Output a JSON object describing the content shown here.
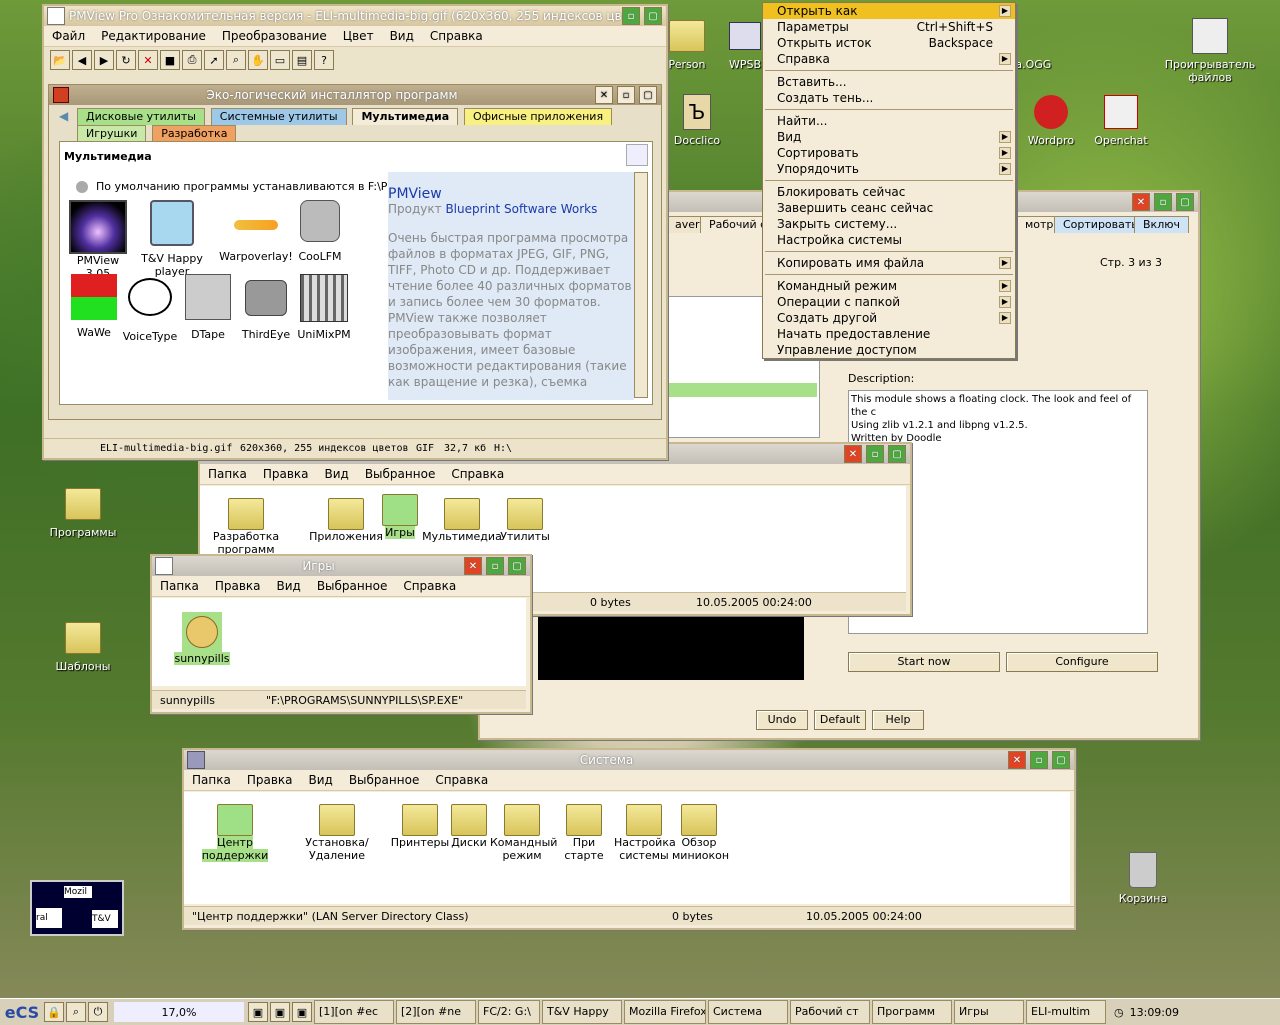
{
  "desktop": {
    "icons": [
      {
        "label": "Programs_label",
        "text": "Программы"
      },
      {
        "label": "templates",
        "text": "Шаблоны"
      },
      {
        "label": "trash",
        "text": "Корзина"
      },
      {
        "label": "player",
        "text": "Проигрыватель файлов"
      },
      {
        "label": "docclico",
        "text": "Docclico"
      },
      {
        "label": "wordpro",
        "text": "Wordpro"
      },
      {
        "label": "openchat",
        "text": "Openchat"
      },
      {
        "label": "person",
        "text": "Person"
      },
      {
        "label": "wpsb",
        "text": "WPSB"
      },
      {
        "label": "ogg",
        "text": "ка.OGG"
      }
    ],
    "mini_monitor": {
      "l1": "Mozil",
      "l2": "T&V",
      "l3": "ral"
    }
  },
  "pmview": {
    "title": "PMView Pro Ознакомительная версия - ELI-multimedia-big.gif (620x360, 255 индексов цв",
    "menu": [
      "Файл",
      "Редактирование",
      "Преобразование",
      "Цвет",
      "Вид",
      "Справка"
    ],
    "status": [
      "ELI-multimedia-big.gif",
      "620x360, 255 индексов цветов",
      "GIF",
      "32,7 кб",
      "H:\\"
    ]
  },
  "installer": {
    "title": "Эко-логический инсталлятор программ",
    "tabs": [
      "Дисковые утилиты",
      "Системные утилиты",
      "Мультимедиа",
      "Офисные приложения",
      "Игрушки",
      "Разработка"
    ],
    "section": "Мультимедиа",
    "default_path": "По умолчанию программы устанавливаются в F:\\PROGRAMS",
    "apps": [
      "PMView 3.05",
      "T&V Happy player",
      "Warpoverlay!",
      "CooLFM",
      "WaWe",
      "VoiceType",
      "DTape",
      "ThirdEye",
      "UniMixPM"
    ],
    "desc_title": "PMView",
    "desc_vendor_prefix": "Продукт",
    "desc_vendor": "Blueprint Software Works",
    "desc_text": "Очень быстрая программа просмотра файлов в форматах JPEG, GIF, PNG, TIFF, Photo CD и др. Поддерживает чтение более 40 различных форматов и запись более чем 30 форматов. PMView также позволяет преобразовывать формат изображения, имеет базовые возможности редактирования (такие как вращение и резка), съемка"
  },
  "context_menu": {
    "items": [
      {
        "label": "Открыть как",
        "accel": "",
        "arrow": true,
        "sel": true
      },
      {
        "label": "Параметры",
        "accel": "Ctrl+Shift+S",
        "arrow": false
      },
      {
        "label": "Открыть исток",
        "accel": "Backspace",
        "arrow": false
      },
      {
        "label": "Справка",
        "accel": "",
        "arrow": true
      },
      {
        "sep": true
      },
      {
        "label": "Вставить...",
        "accel": "",
        "arrow": false
      },
      {
        "label": "Создать тень...",
        "accel": "",
        "arrow": false
      },
      {
        "sep": true
      },
      {
        "label": "Найти...",
        "accel": "",
        "arrow": false
      },
      {
        "label": "Вид",
        "accel": "",
        "arrow": true
      },
      {
        "label": "Сортировать",
        "accel": "",
        "arrow": true
      },
      {
        "label": "Упорядочить",
        "accel": "",
        "arrow": true
      },
      {
        "sep": true
      },
      {
        "label": "Блокировать сейчас",
        "accel": "",
        "arrow": false
      },
      {
        "label": "Завершить сеанс сейчас",
        "accel": "",
        "arrow": false
      },
      {
        "label": "Закрыть систему...",
        "accel": "",
        "arrow": false
      },
      {
        "label": "Настройка системы",
        "accel": "",
        "arrow": false
      },
      {
        "sep": true
      },
      {
        "label": "Копировать имя файла",
        "accel": "",
        "arrow": true
      },
      {
        "sep": true
      },
      {
        "label": "Командный режим",
        "accel": "",
        "arrow": true
      },
      {
        "label": "Операции с папкой",
        "accel": "",
        "arrow": true
      },
      {
        "label": "Создать другой",
        "accel": "",
        "arrow": true
      },
      {
        "label": "Начать предоставление",
        "accel": "",
        "arrow": false
      },
      {
        "label": "Управление доступом",
        "accel": "",
        "arrow": false
      }
    ]
  },
  "desktop_settings": {
    "tabs": [
      "aver",
      "Рабочий сто",
      "мотр",
      "Сортировать",
      "Включ"
    ],
    "page": "Стр. 3 из 3",
    "desc_label": "Description:",
    "desc_lines": [
      "This module shows a floating clock. The look and feel of the c",
      "Using zlib v1.2.1 and libpng v1.2.5.",
      "Written by Doodle"
    ],
    "start_btn": "Start now",
    "configure_btn": "Configure",
    "undo_btn": "Undo",
    "default_btn": "Default",
    "help_btn": "Help"
  },
  "programs_folder": {
    "menu": [
      "Папка",
      "Правка",
      "Вид",
      "Выбранное",
      "Справка"
    ],
    "items": [
      "Разработка программ",
      "Приложения",
      "Игры",
      "Мультимедиа",
      "Утилиты"
    ],
    "status_size": "0 bytes",
    "status_date": "10.05.2005 00:24:00"
  },
  "games": {
    "title": "Игры",
    "menu": [
      "Папка",
      "Правка",
      "Вид",
      "Выбранное",
      "Справка"
    ],
    "item": "sunnypills",
    "status_name": "sunnypills",
    "status_path": "\"F:\\PROGRAMS\\SUNNYPILLS\\SP.EXE\""
  },
  "system": {
    "title": "Система",
    "menu": [
      "Папка",
      "Правка",
      "Вид",
      "Выбранное",
      "Справка"
    ],
    "items": [
      "Центр поддержки",
      "Установка/Удаление",
      "Принтеры",
      "Диски",
      "Командный режим",
      "При старте",
      "Настройка системы",
      "Обзор миниокон"
    ],
    "status_name": "\"Центр поддержки\" (LAN Server Directory Class)",
    "status_size": "0 bytes",
    "status_date": "10.05.2005 00:24:00"
  },
  "taskbar": {
    "cpu": "17,0%",
    "tasks": [
      "[1][on #ec",
      "[2][on #ne",
      "FC/2: G:\\",
      "T&V Happy",
      "Mozilla Firefox",
      "Система",
      "Рабочий ст",
      "Программ",
      "Игры",
      "ELI-multim"
    ],
    "clock": "13:09:09"
  }
}
